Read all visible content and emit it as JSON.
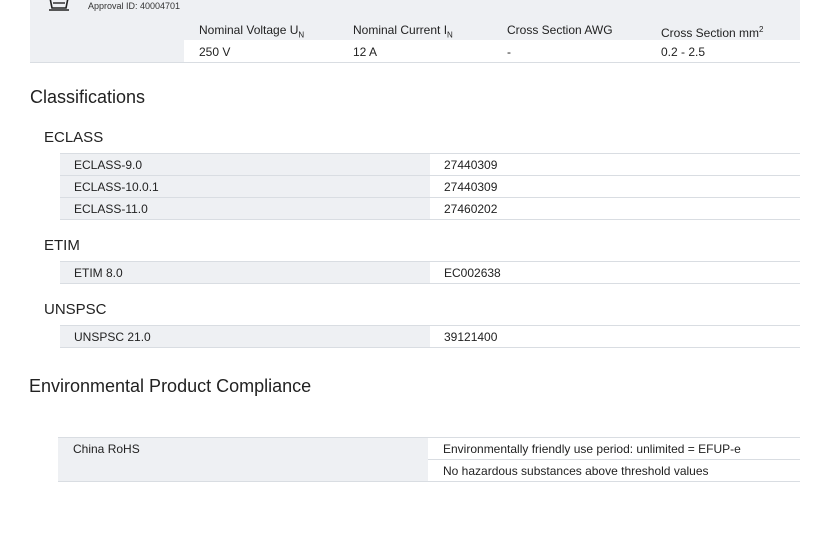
{
  "approval": {
    "id_text": "Approval ID: 40004701"
  },
  "ratings": {
    "headers": [
      "Nominal Voltage U",
      "Nominal Current I",
      "Cross Section AWG",
      "Cross Section mm"
    ],
    "subscripts": [
      "N",
      "N"
    ],
    "superscript": "2",
    "values": [
      "250 V",
      "12 A",
      "-",
      "0.2 - 2.5"
    ]
  },
  "classifications": {
    "title": "Classifications",
    "eclass": {
      "title": "ECLASS",
      "rows": [
        {
          "label": "ECLASS-9.0",
          "value": "27440309"
        },
        {
          "label": "ECLASS-10.0.1",
          "value": "27440309"
        },
        {
          "label": "ECLASS-11.0",
          "value": "27460202"
        }
      ]
    },
    "etim": {
      "title": "ETIM",
      "rows": [
        {
          "label": "ETIM 8.0",
          "value": "EC002638"
        }
      ]
    },
    "unspsc": {
      "title": "UNSPSC",
      "rows": [
        {
          "label": "UNSPSC 21.0",
          "value": "39121400"
        }
      ]
    }
  },
  "environmental": {
    "title": "Environmental Product Compliance",
    "china_rohs": {
      "label": "China RoHS",
      "values": [
        "Environmentally friendly use period: unlimited = EFUP-e",
        "No hazardous substances above threshold values"
      ]
    }
  }
}
